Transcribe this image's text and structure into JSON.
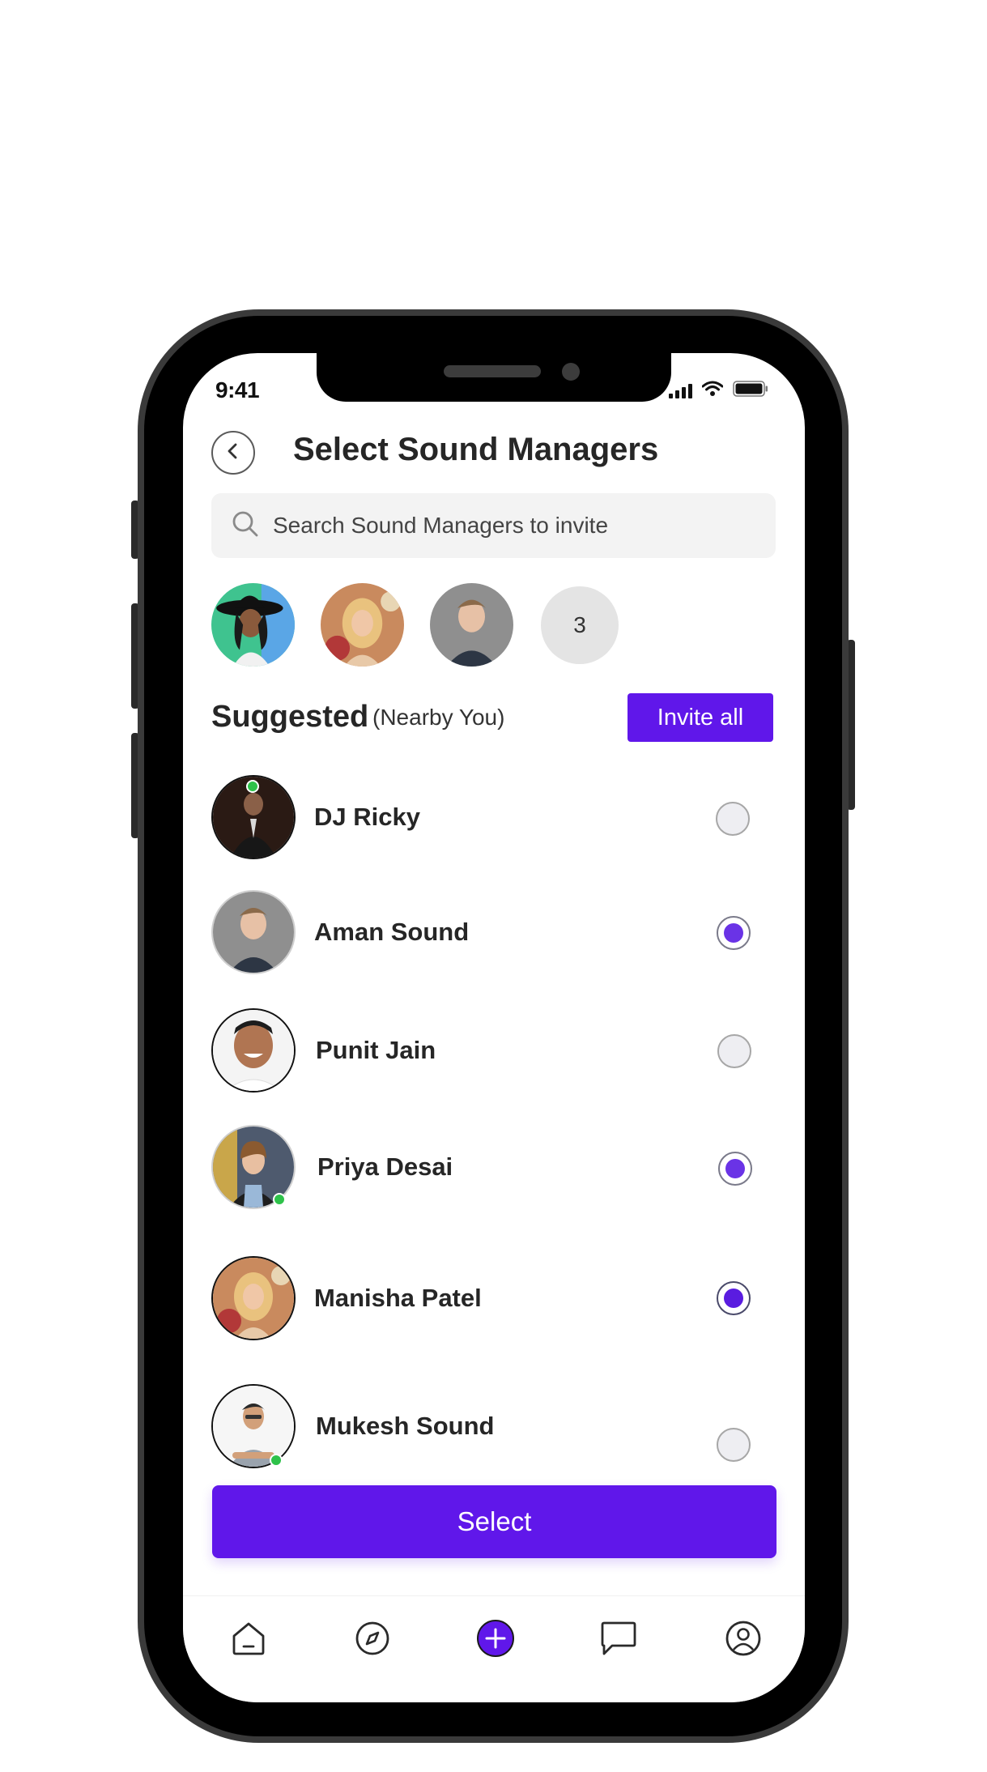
{
  "status_bar": {
    "time": "9:41"
  },
  "header": {
    "title": "Select Sound Managers"
  },
  "search": {
    "placeholder": "Search Sound Managers to invite"
  },
  "selected_strip": {
    "extra_count": "3"
  },
  "suggested": {
    "title": "Suggested",
    "subtitle": "(Nearby You)",
    "invite_all_label": "Invite all"
  },
  "list": [
    {
      "name": "DJ Ricky",
      "selected": false,
      "online": true
    },
    {
      "name": "Aman Sound",
      "selected": true,
      "online": false
    },
    {
      "name": "Punit Jain",
      "selected": false,
      "online": false
    },
    {
      "name": "Priya Desai",
      "selected": true,
      "online": true
    },
    {
      "name": "Manisha Patel",
      "selected": true,
      "online": false
    },
    {
      "name": "Mukesh Sound",
      "selected": false,
      "online": true
    }
  ],
  "footer": {
    "select_label": "Select"
  },
  "tab_bar": {
    "active": "add"
  },
  "colors": {
    "accent": "#6017ea",
    "radio_dot": "#6a33e6",
    "online": "#2ec24a",
    "search_bg": "#f3f3f3"
  },
  "icons": [
    "chevron-left-icon",
    "search-icon",
    "signal-icon",
    "wifi-icon",
    "battery-icon",
    "home-icon",
    "compass-icon",
    "plus-icon",
    "chat-icon",
    "profile-icon"
  ]
}
